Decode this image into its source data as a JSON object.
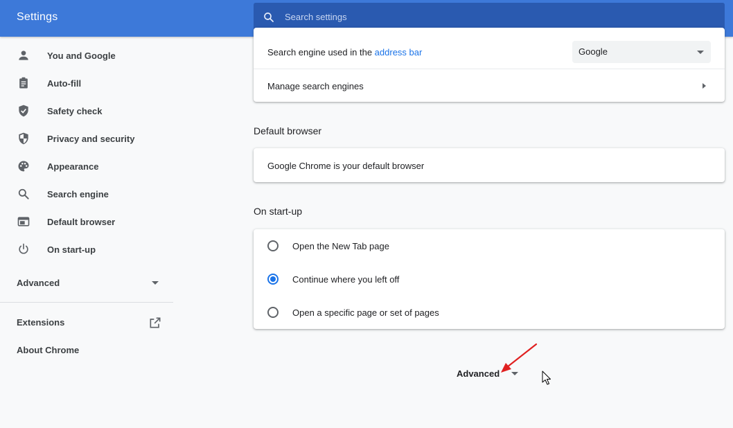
{
  "app": {
    "title": "Settings"
  },
  "search": {
    "placeholder": "Search settings"
  },
  "sidebar": {
    "items": [
      {
        "label": "You and Google",
        "icon": "person-icon"
      },
      {
        "label": "Auto-fill",
        "icon": "clipboard-icon"
      },
      {
        "label": "Safety check",
        "icon": "shield-check-icon"
      },
      {
        "label": "Privacy and security",
        "icon": "shield-half-icon"
      },
      {
        "label": "Appearance",
        "icon": "palette-icon"
      },
      {
        "label": "Search engine",
        "icon": "search-icon"
      },
      {
        "label": "Default browser",
        "icon": "browser-window-icon"
      },
      {
        "label": "On start-up",
        "icon": "power-icon"
      }
    ],
    "advanced_label": "Advanced",
    "extensions_label": "Extensions",
    "about_label": "About Chrome"
  },
  "search_engine": {
    "row_text_prefix": "Search engine used in the ",
    "row_link": "address bar",
    "selected_engine": "Google",
    "manage_label": "Manage search engines"
  },
  "default_browser": {
    "title": "Default browser",
    "status": "Google Chrome is your default browser"
  },
  "startup": {
    "title": "On start-up",
    "options": [
      {
        "label": "Open the New Tab page",
        "selected": false
      },
      {
        "label": "Continue where you left off",
        "selected": true
      },
      {
        "label": "Open a specific page or set of pages",
        "selected": false
      }
    ]
  },
  "advanced_button": {
    "label": "Advanced"
  },
  "colors": {
    "header": "#3d79d9",
    "search_bg": "#2a5ab0",
    "accent": "#1a73e8",
    "annotation_arrow": "#e02020"
  }
}
